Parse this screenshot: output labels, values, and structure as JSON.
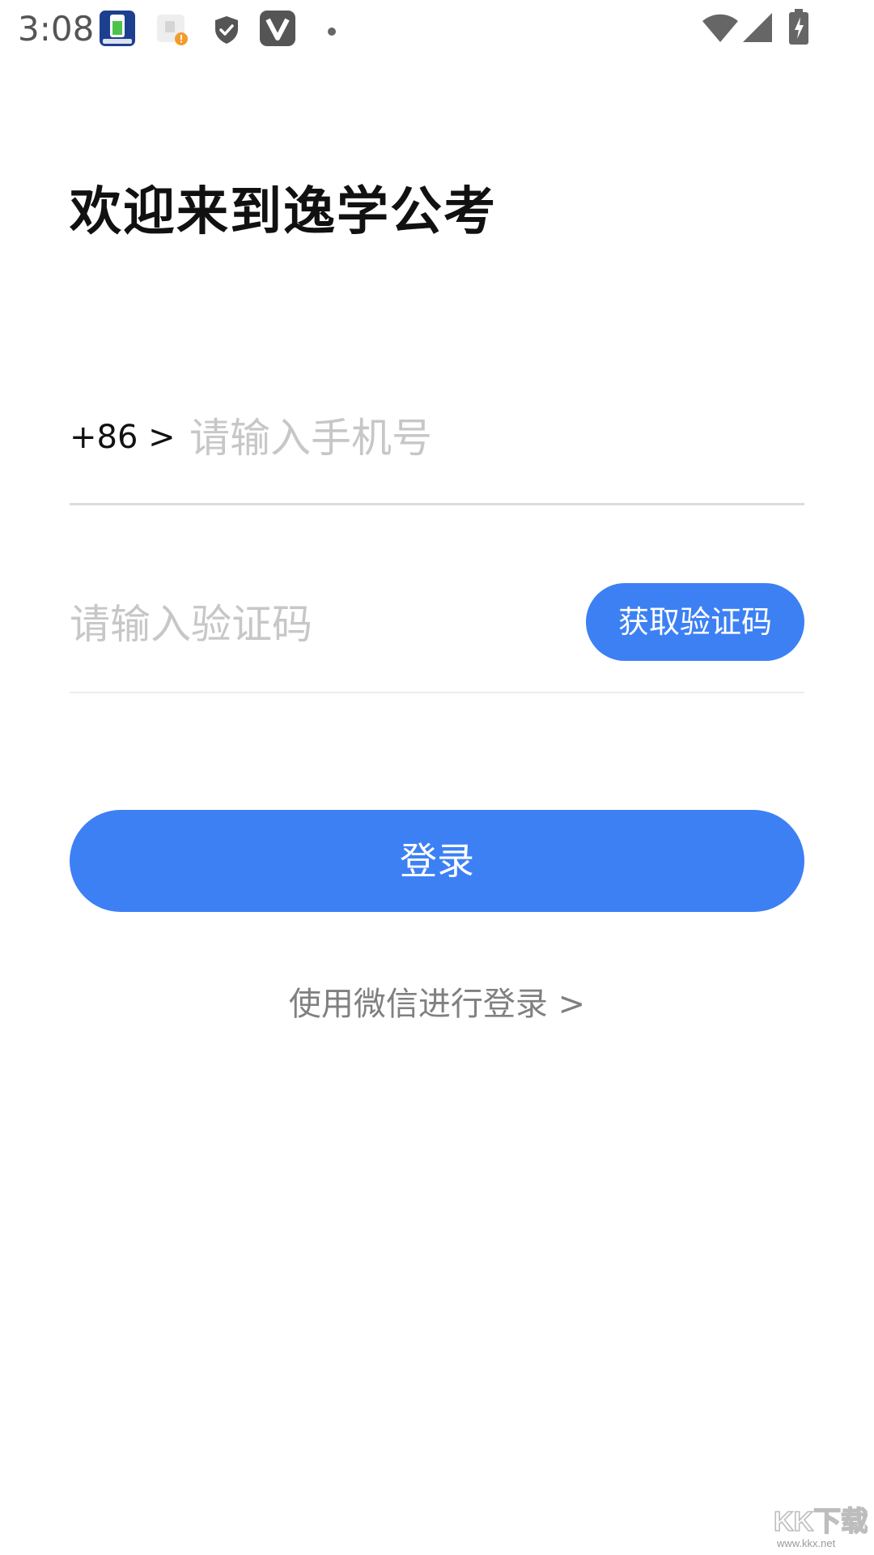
{
  "status_bar": {
    "time": "3:08",
    "icons": [
      "battery-app-icon",
      "app-notification-icon",
      "shield-icon",
      "v-app-icon",
      "dot-icon",
      "wifi-icon",
      "signal-icon",
      "battery-charging-icon"
    ]
  },
  "title": "欢迎来到逸学公考",
  "phone": {
    "country_code": "+86 >",
    "placeholder": "请输入手机号",
    "value": ""
  },
  "verification": {
    "placeholder": "请输入验证码",
    "value": "",
    "get_code_label": "获取验证码"
  },
  "login_label": "登录",
  "wechat_login_label": "使用微信进行登录 >",
  "watermark": {
    "logo_text": "KK下载",
    "url_text": "www.kkx.net"
  },
  "colors": {
    "accent": "#3d80f4",
    "placeholder": "#c7c7c7",
    "secondary_text": "#808080",
    "divider": "#dcdcdc"
  }
}
